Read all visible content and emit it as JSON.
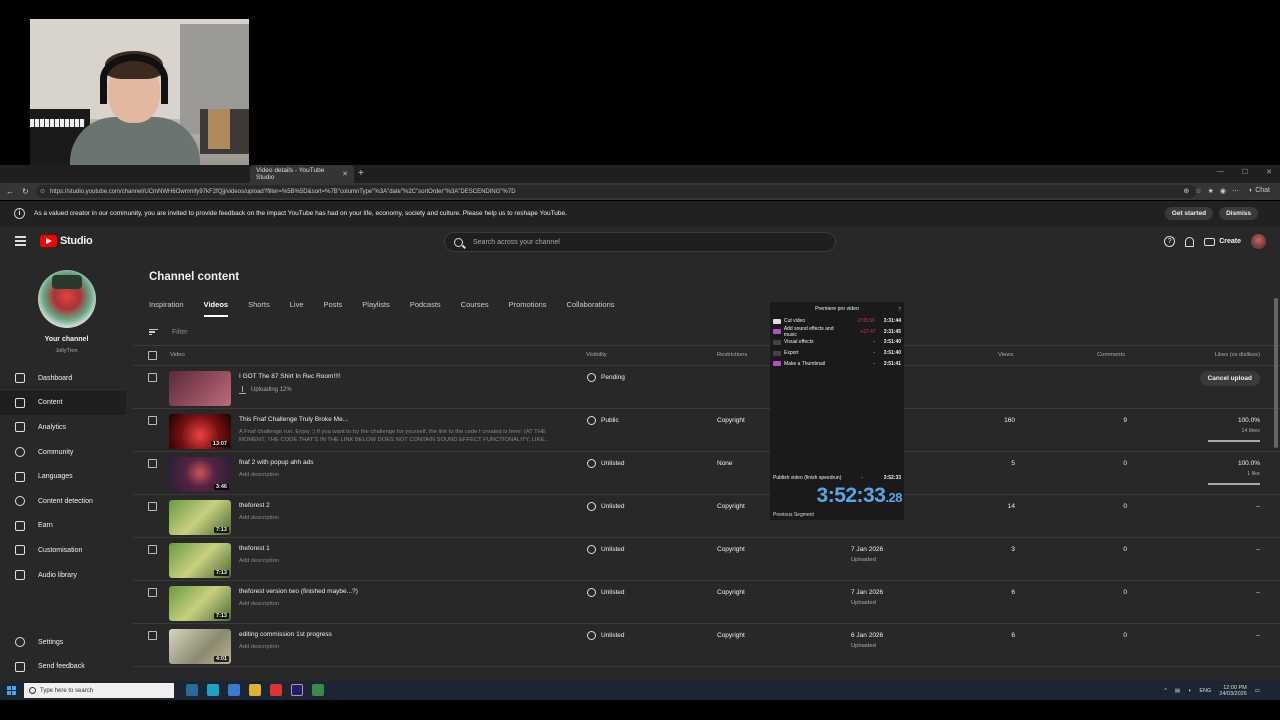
{
  "browser": {
    "tab_title": "Video details - YouTube Studio",
    "url": "https://studio.youtube.com/channel/UCmNWH6Owmmfy97kF2fQjj/videos/upload?filter=%5B%5D&sort=%7B\"columnType\"%3A\"date\"%2C\"sortOrder\"%3A\"DESCENDING\"%7D",
    "chat_label": "Chat"
  },
  "banner": {
    "message": "As a valued creator in our community, you are invited to provide feedback on the impact YouTube has had on your life, economy, society and culture. Please help us to reshape YouTube.",
    "get_started": "Get started",
    "dismiss": "Dismiss"
  },
  "topbar": {
    "logo_text": "Studio",
    "search_placeholder": "Search across your channel",
    "create_label": "Create"
  },
  "sidebar": {
    "channel_title": "Your channel",
    "channel_handle": "JollyTron",
    "items": [
      {
        "label": "Dashboard",
        "icon": "dashboard-icon"
      },
      {
        "label": "Content",
        "icon": "content-icon"
      },
      {
        "label": "Analytics",
        "icon": "analytics-icon"
      },
      {
        "label": "Community",
        "icon": "community-icon"
      },
      {
        "label": "Languages",
        "icon": "languages-icon"
      },
      {
        "label": "Content detection",
        "icon": "copyright-icon"
      },
      {
        "label": "Earn",
        "icon": "earn-icon"
      },
      {
        "label": "Customisation",
        "icon": "customisation-icon"
      },
      {
        "label": "Audio library",
        "icon": "audio-library-icon"
      }
    ],
    "bottom": [
      {
        "label": "Settings",
        "icon": "gear-icon"
      },
      {
        "label": "Send feedback",
        "icon": "feedback-icon"
      }
    ]
  },
  "main": {
    "title": "Channel content",
    "tabs": [
      "Inspiration",
      "Videos",
      "Shorts",
      "Live",
      "Posts",
      "Playlists",
      "Podcasts",
      "Courses",
      "Promotions",
      "Collaborations"
    ],
    "filter_label": "Filter",
    "headers": {
      "video": "Video",
      "visibility": "Visibility",
      "restrictions": "Restrictions",
      "views": "Views",
      "comments": "Comments",
      "likes": "Likes (vs dislikes)"
    },
    "rows": [
      {
        "title": "I GOT The 87 Shirt In Rec Room!!!!",
        "status": "Uploading 12%",
        "visibility": "Pending",
        "cancel": "Cancel upload",
        "thumb_color": "#8a4a5a"
      },
      {
        "title": "This Fnaf Challenge Truly Broke Me...",
        "desc": "A Fnaf challenge run. Enjoy :) If you want to try the challenge for yourself, the link to the code I created is here: (AT THE MOMENT, THE CODE THAT'S IN THE LINK BELOW DOES NOT CONTAIN SOUND EFFECT FUNCTIONALITY, LIKE...",
        "visibility": "Public",
        "restrictions": "Copyright",
        "views": "160",
        "comments": "9",
        "likes": "100.0%",
        "likes_count": "14 likes",
        "duration": "13:07",
        "thumb_color": "#7a1a1a"
      },
      {
        "title": "fnaf 2 with popup ahh ads",
        "desc": "Add description",
        "visibility": "Unlisted",
        "restrictions": "None",
        "views": "5",
        "comments": "0",
        "likes": "100.0%",
        "likes_count": "1 like",
        "duration": "3:46",
        "thumb_color": "#3a2a4a"
      },
      {
        "title": "theforest 2",
        "desc": "Add description",
        "visibility": "Unlisted",
        "restrictions": "Copyright",
        "views": "14",
        "comments": "0",
        "likes": "–",
        "duration": "7:13",
        "thumb_color": "#5a8a3a"
      },
      {
        "title": "theforest 1",
        "desc": "Add description",
        "visibility": "Unlisted",
        "restrictions": "Copyright",
        "date": "7 Jan 2026",
        "date_status": "Uploaded",
        "views": "3",
        "comments": "0",
        "likes": "–",
        "duration": "7:13",
        "thumb_color": "#5a8a3a"
      },
      {
        "title": "theforest version two (finished maybe...?)",
        "desc": "Add description",
        "visibility": "Unlisted",
        "restrictions": "Copyright",
        "date": "7 Jan 2026",
        "date_status": "Uploaded",
        "views": "6",
        "comments": "0",
        "likes": "–",
        "duration": "7:13",
        "thumb_color": "#5a8a3a"
      },
      {
        "title": "editing commission 1st progress",
        "desc": "Add description",
        "visibility": "Unlisted",
        "restrictions": "Copyright",
        "date": "6 Jan 2026",
        "date_status": "Uploaded",
        "views": "6",
        "comments": "0",
        "likes": "–",
        "duration": "4:01",
        "thumb_color": "#9a9a80"
      }
    ]
  },
  "speedrun": {
    "title": "Premiere pro video",
    "splits": [
      {
        "name": "Cut video",
        "delta": "-2:05:56",
        "time": "3:31:44",
        "color": "#dddddd"
      },
      {
        "name": "Add sound effects and music",
        "delta": "+27:47",
        "time": "3:31:45",
        "color": "#b34fc6"
      },
      {
        "name": "Visual effects",
        "delta": "-",
        "time": "3:51:40",
        "color": "#444444"
      },
      {
        "name": "Export",
        "delta": "-",
        "time": "3:51:40",
        "color": "#444444"
      },
      {
        "name": "Make a Thumbnail",
        "delta": "-",
        "time": "3:51:41",
        "color": "#b34fc6"
      }
    ],
    "last_split": "Publish video (finish speedrun)",
    "last_time": "3:52:33",
    "timer_main": "3:52:33",
    "timer_frac": ".28",
    "prev_label": "Previous Segment"
  },
  "taskbar": {
    "search_placeholder": "Type here to search",
    "lang": "ENG",
    "time": "12:00 PM",
    "date": "24/03/2026"
  }
}
